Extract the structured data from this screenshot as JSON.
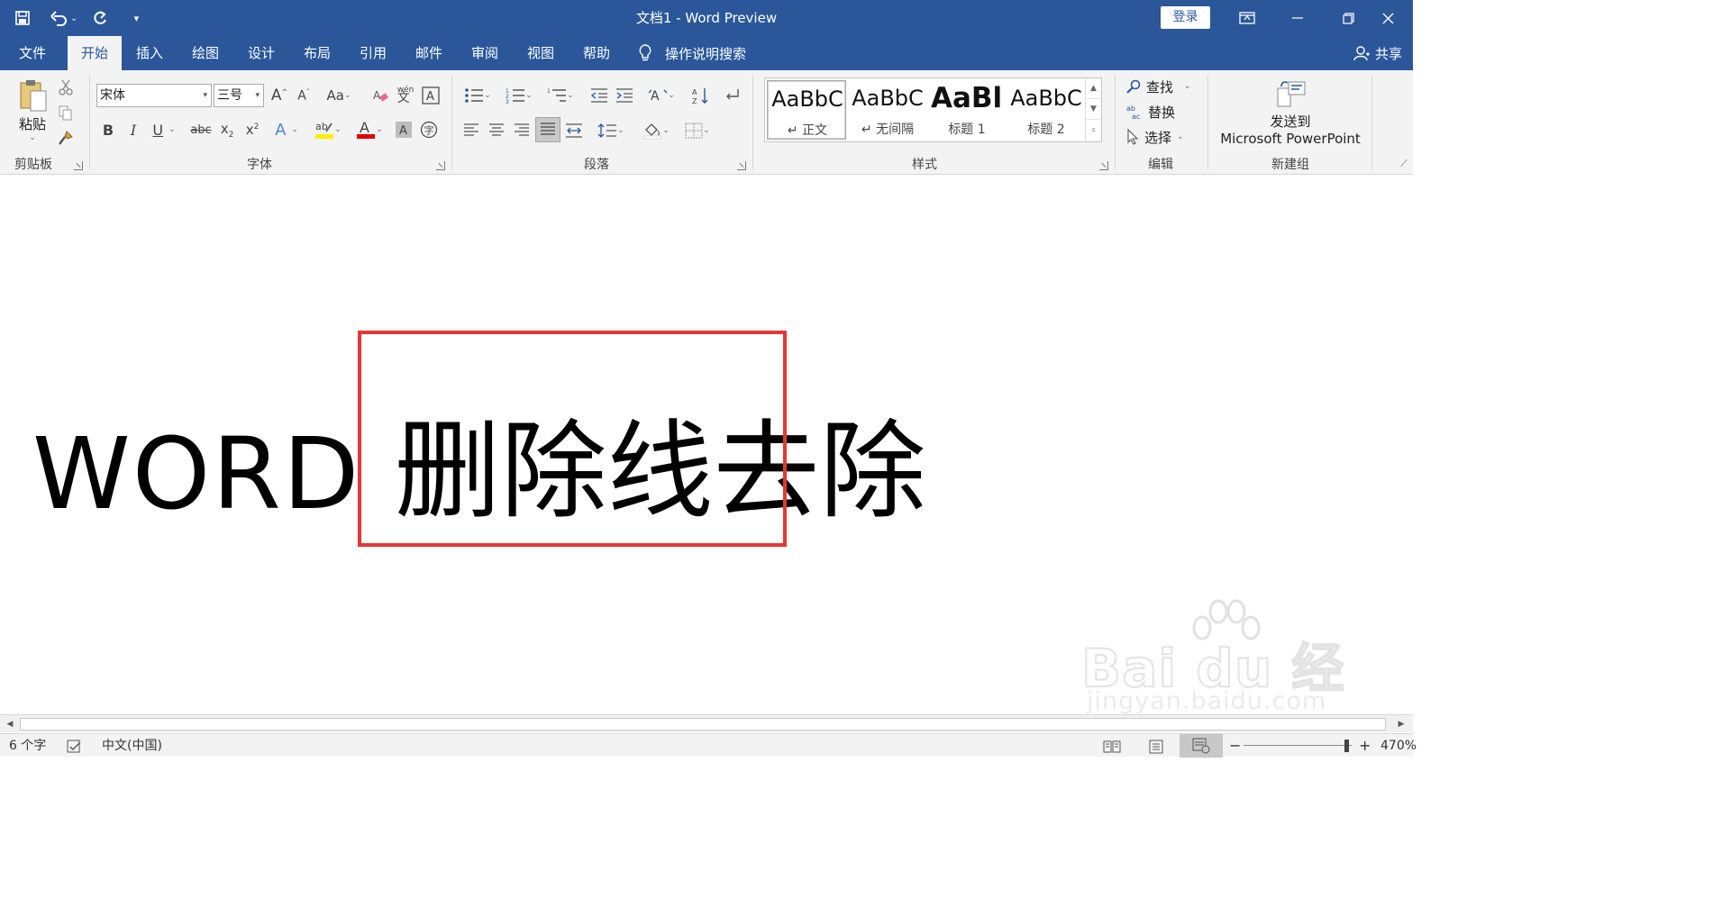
{
  "titlebar": {
    "title": "文档1  -  Word Preview",
    "login": "登录"
  },
  "tabs": [
    {
      "label": "文件",
      "active": false
    },
    {
      "label": "开始",
      "active": true
    },
    {
      "label": "插入",
      "active": false
    },
    {
      "label": "绘图",
      "active": false
    },
    {
      "label": "设计",
      "active": false
    },
    {
      "label": "布局",
      "active": false
    },
    {
      "label": "引用",
      "active": false
    },
    {
      "label": "邮件",
      "active": false
    },
    {
      "label": "审阅",
      "active": false
    },
    {
      "label": "视图",
      "active": false
    },
    {
      "label": "帮助",
      "active": false
    }
  ],
  "tellme": "操作说明搜索",
  "share": "共享",
  "ribbon": {
    "clipboard": {
      "paste": "粘贴",
      "label": "剪贴板"
    },
    "font": {
      "name": "宋体",
      "size": "三号",
      "label": "字体"
    },
    "paragraph": {
      "label": "段落"
    },
    "styles": {
      "label": "样式",
      "items": [
        {
          "sample": "AaBbC",
          "name": "↵ 正文"
        },
        {
          "sample": "AaBbC",
          "name": "↵ 无间隔"
        },
        {
          "sample": "AaBl",
          "name": "标题 1"
        },
        {
          "sample": "AaBbC",
          "name": "标题 2"
        }
      ]
    },
    "editing": {
      "find": "查找",
      "replace": "替换",
      "select": "选择",
      "label": "编辑"
    },
    "newgroup": {
      "line1": "发送到",
      "line2": "Microsoft PowerPoint",
      "label": "新建组"
    }
  },
  "document": {
    "latin": "WORD ",
    "cjk": "删除线去除"
  },
  "watermark": {
    "main": "Bai du 经验",
    "sub": "jingyan.baidu.com"
  },
  "status": {
    "words": "6 个字",
    "language": "中文(中国)",
    "zoom": "470%"
  },
  "colors": {
    "brand": "#2b579a",
    "highlight": "#e8353a",
    "font_color_bar": "#e00000",
    "highlighter_bar": "#ffee00"
  }
}
